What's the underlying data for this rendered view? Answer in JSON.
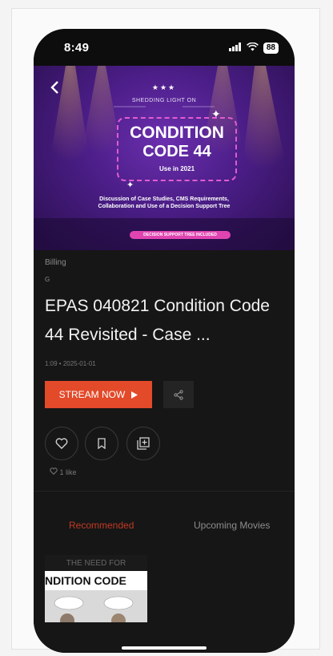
{
  "status": {
    "time": "8:49",
    "battery": "88"
  },
  "hero": {
    "stars": "★★★",
    "kicker": "SHEDDING LIGHT ON",
    "title_line1": "CONDITION",
    "title_line2": "CODE 44",
    "use_text": "Use in 2021",
    "description": "Discussion of Case Studies, CMS Requirements, Collaboration and Use of a Decision Support Tree",
    "pill": "DECISION SUPPORT TREE INCLUDED"
  },
  "detail": {
    "category": "Billing",
    "rating": "G",
    "title": "EPAS 040821 Condition Code 44 Revisited - Case ...",
    "meta": "1:09  •  2025-01-01",
    "stream_label": "STREAM NOW",
    "likes": "1 like"
  },
  "tabs": [
    {
      "label": "Recommended",
      "active": true
    },
    {
      "label": "Upcoming Movies",
      "active": false
    }
  ],
  "thumbnail": {
    "top_text": "THE NEED FOR",
    "main_text": "NDITION CODE"
  },
  "colors": {
    "accent": "#e24a2a",
    "tab_active": "#c23a23",
    "background": "#161616"
  },
  "icons": {
    "back": "chevron-left-icon",
    "signal": "signal-icon",
    "wifi": "wifi-icon",
    "play": "play-icon",
    "share": "share-icon",
    "heart": "heart-icon",
    "bookmark": "bookmark-icon",
    "add_playlist": "add-playlist-icon"
  }
}
